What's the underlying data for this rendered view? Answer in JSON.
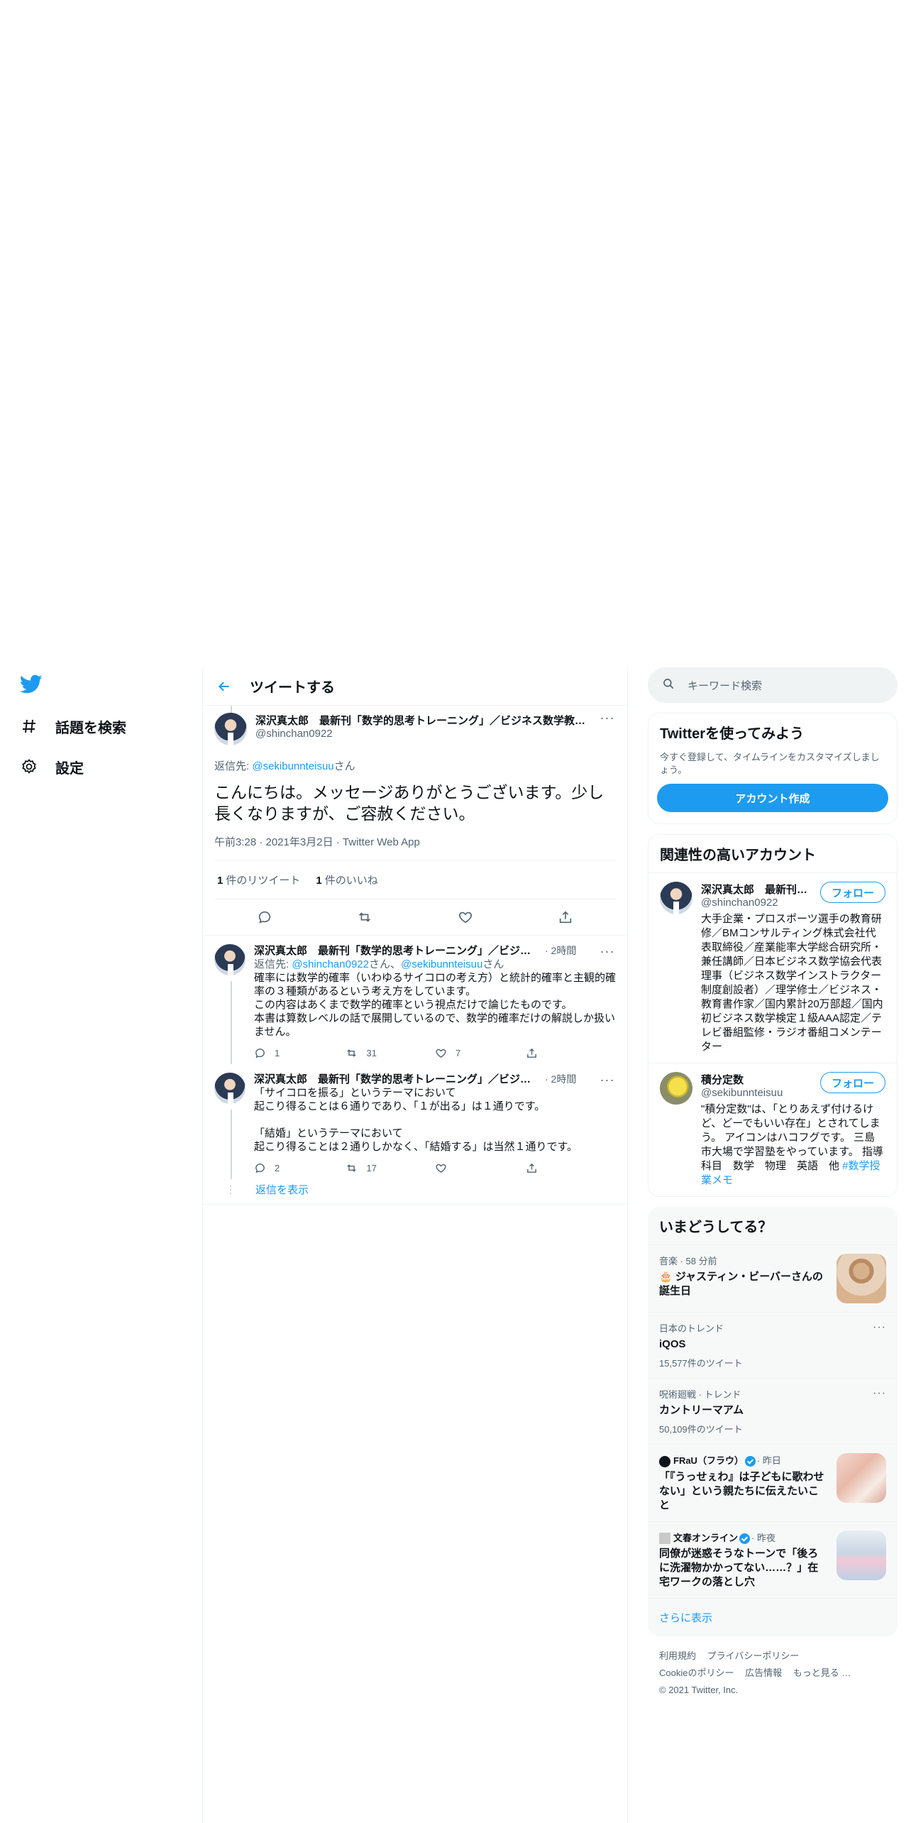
{
  "nav": {
    "explore_label": "話題を検索",
    "settings_label": "設定"
  },
  "header": {
    "title": "ツイートする"
  },
  "focus_tweet": {
    "author": "深沢真太郎　最新刊「数学的思考トレーニング」／ビジネス数学教…",
    "handle": "@shinchan0922",
    "reply_prefix": "返信先: ",
    "reply_handle": "@sekibunnteisuu",
    "reply_suffix": "さん",
    "text": "こんにちは。メッセージありがとうございます。少し長くなりますが、ご容赦ください。",
    "time": "午前3:28 · 2021年3月2日 · Twitter Web App",
    "retweets_count": "1",
    "retweets_label": "件のリツイート",
    "likes_count": "1",
    "likes_label": "件のいいね"
  },
  "replies": [
    {
      "author": "深沢真太郎　最新刊「数学的思考トレーニング」／ビジネ…",
      "time": "· 2時間",
      "reply_prefix": "返信先: ",
      "reply_handle1": "@shinchan0922",
      "reply_mid": "さん、",
      "reply_handle2": "@sekibunnteisuu",
      "reply_suffix": "さん",
      "lines": [
        "確率には数学的確率（いわゆるサイコロの考え方）と統計的確率と主観的確率の３種類があるという考え方をしています。",
        "この内容はあくまで数学的確率という視点だけで論じたものです。",
        "本書は算数レベルの話で展開しているので、数学的確率だけの解説しか扱いません。"
      ],
      "replies": "1",
      "retweets": "31",
      "likes": "7"
    },
    {
      "author": "深沢真太郎　最新刊「数学的思考トレーニング」／ビジネ…",
      "time": "· 2時間",
      "lines": [
        "「サイコロを振る」というテーマにおいて",
        "起こり得ることは６通りであり、「１が出る」は１通りです。",
        "",
        "「結婚」というテーマにおいて",
        "起こり得ることは２通りしかなく、「結婚する」は当然１通りです。"
      ],
      "replies": "2",
      "retweets": "17",
      "likes": ""
    }
  ],
  "show_replies_label": "返信を表示",
  "search": {
    "placeholder": "キーワード検索"
  },
  "signup": {
    "title": "Twitterを使ってみよう",
    "desc": "今すぐ登録して、タイムラインをカスタマイズしましょう。",
    "button": "アカウント作成"
  },
  "related": {
    "title": "関連性の高いアカウント",
    "accounts": [
      {
        "name": "深沢真太郎　最新刊…",
        "handle": "@shinchan0922",
        "follow": "フォロー",
        "bio": "大手企業・プロスポーツ選手の教育研修／BMコンサルティング株式会社代表取締役／産業能率大学総合研究所・兼任講師／日本ビジネス数学協会代表理事（ビジネス数学インストラクター制度創設者）／理学修士／ビジネス・教育書作家／国内累計20万部超／国内初ビジネス数学検定１級AAA認定／テレビ番組監修・ラジオ番組コメンテーター"
      },
      {
        "name": "積分定数",
        "handle": "@sekibunnteisuu",
        "follow": "フォロー",
        "bio": "\"積分定数\"は、「とりあえず付けるけど、どーでもいい存在」とされてしまう。 アイコンはハコフグです。 三島市大場で学習塾をやっています。 指導科目　数学　物理　英語　他 ",
        "bio_link": "#数学授業メモ"
      }
    ]
  },
  "trends": {
    "title": "いまどうしてる？",
    "items": [
      {
        "context": "音楽 · 58 分前",
        "title": "🎂 ジャスティン・ビーバーさんの誕生日",
        "count": ""
      },
      {
        "context": "日本のトレンド",
        "title": "iQOS",
        "count": "15,577件のツイート"
      },
      {
        "context": "呪術廻戦 · トレンド",
        "title": "カントリーマアム",
        "count": "50,109件のツイート"
      },
      {
        "context_src": "FRaU（フラウ）",
        "context_time": "· 昨日",
        "title": "「『うっせぇわ』は子どもに歌わせない」という親たちに伝えたいこと"
      },
      {
        "context_src": "文春オンライン",
        "context_time": "· 昨夜",
        "title": "同僚が迷惑そうなトーンで「後ろに洗濯物かかってない……？」在宅ワークの落とし穴"
      }
    ],
    "show_more": "さらに表示"
  },
  "footer": {
    "links1": [
      "利用規約",
      "プライバシーポリシー"
    ],
    "links2": [
      "Cookieのポリシー",
      "広告情報",
      "もっと見る …"
    ],
    "copyright": "© 2021 Twitter, Inc."
  },
  "colors": {
    "accent": "#1d9bf0",
    "text": "#0f1419",
    "muted": "#536471",
    "border": "#eff3f4"
  }
}
